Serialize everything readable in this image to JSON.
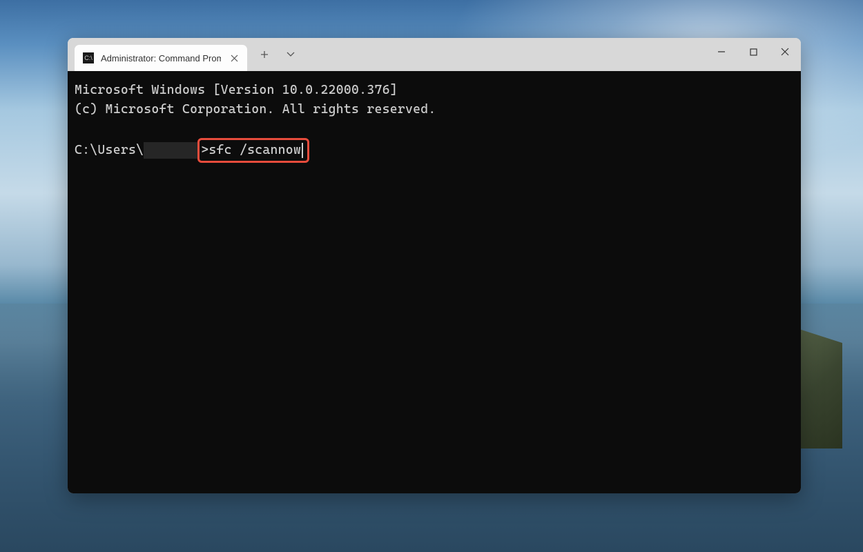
{
  "tab": {
    "title": "Administrator: Command Prompt"
  },
  "terminal": {
    "line1": "Microsoft Windows [Version 10.0.22000.376]",
    "line2": "(c) Microsoft Corporation. All rights reserved.",
    "prompt_prefix": "C:\\Users\\",
    "prompt_suffix": ">",
    "command": "sfc /scannow"
  },
  "icons": {
    "close_glyph": "✕",
    "plus_glyph": "＋"
  },
  "colors": {
    "highlight": "#e74c3c"
  }
}
